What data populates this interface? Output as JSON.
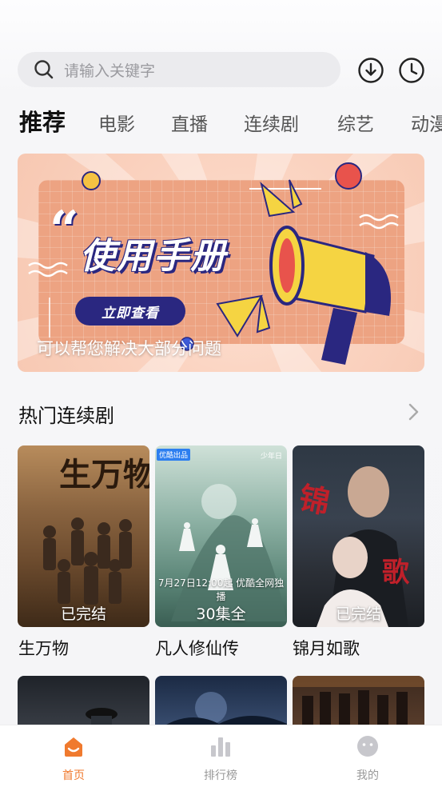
{
  "search": {
    "placeholder": "请输入关键字"
  },
  "header_icons": [
    "download-icon",
    "history-clock-icon"
  ],
  "tabs": [
    {
      "label": "推荐",
      "active": true
    },
    {
      "label": "电影"
    },
    {
      "label": "直播"
    },
    {
      "label": "连续剧"
    },
    {
      "label": "综艺"
    },
    {
      "label": "动漫"
    }
  ],
  "banner": {
    "title": "使用手册",
    "button_label": "立即查看",
    "caption": "可以帮您解决大部分问题"
  },
  "section": {
    "title": "热门连续剧"
  },
  "posters": [
    {
      "title": "生万物",
      "status": "已完结"
    },
    {
      "title": "凡人修仙传",
      "status": "30集全",
      "badge": "优酷出品",
      "watermark": "少年日",
      "date_text": "7月27日12:00起 优酷全网独播"
    },
    {
      "title": "锦月如歌",
      "status": "已完结"
    }
  ],
  "tabbar": [
    {
      "label": "首页",
      "icon": "home-icon",
      "active": true
    },
    {
      "label": "排行榜",
      "icon": "bar-chart-icon"
    },
    {
      "label": "我的",
      "icon": "profile-face-icon"
    }
  ],
  "colors": {
    "accent": "#f07a2e",
    "banner_card": "#eda382",
    "banner_navy": "#2a2780"
  }
}
